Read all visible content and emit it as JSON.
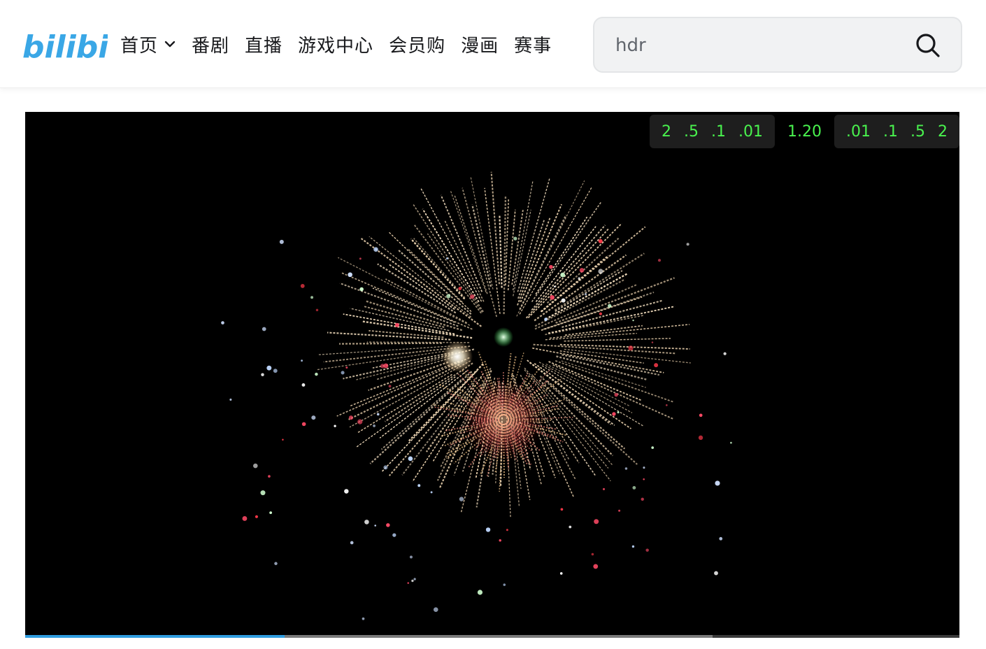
{
  "brand": {
    "logo_text": "bilibili",
    "accent": "#00a1d6",
    "logo_color": "#3aa7e6"
  },
  "nav": {
    "items": [
      {
        "label": "首页",
        "dropdown": true
      },
      {
        "label": "番剧"
      },
      {
        "label": "直播"
      },
      {
        "label": "游戏中心"
      },
      {
        "label": "会员购"
      },
      {
        "label": "漫画"
      },
      {
        "label": "赛事"
      }
    ]
  },
  "search": {
    "value": "hdr",
    "icon": "search-icon"
  },
  "player": {
    "scale_left": [
      "2",
      ".5",
      ".1",
      ".01"
    ],
    "scale_center": "1.20",
    "scale_right": [
      ".01",
      ".1",
      ".5",
      "2"
    ],
    "scale_color": "#49f24e",
    "progress_played": 0.278,
    "progress_buffered": 0.736,
    "progress_color": "#2f9de0"
  }
}
